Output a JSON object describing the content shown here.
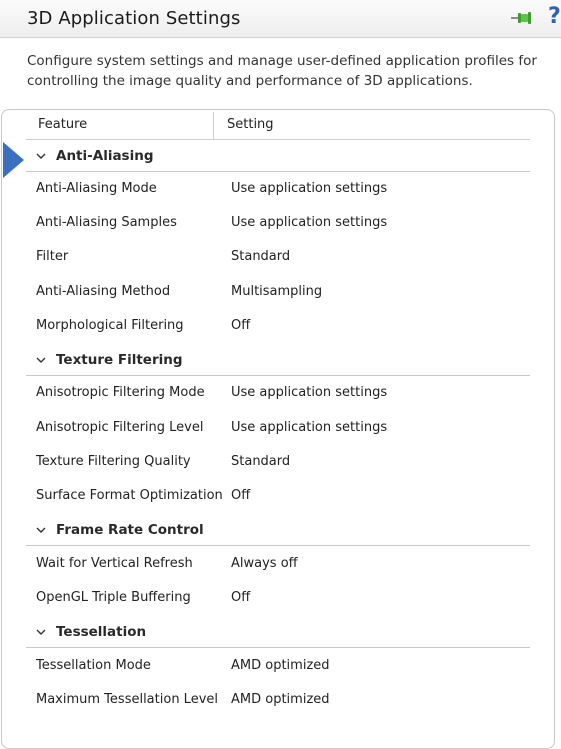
{
  "header": {
    "title": "3D Application Settings",
    "pin_icon": "pin-icon",
    "help_icon": "help-icon",
    "help_glyph": "?"
  },
  "description": "Configure system settings and manage user-defined application profiles for controlling the image quality and performance of 3D applications.",
  "table": {
    "columns": {
      "feature": "Feature",
      "setting": "Setting"
    },
    "groups": [
      {
        "label": "Anti-Aliasing",
        "rows": [
          {
            "feature": "Anti-Aliasing Mode",
            "setting": "Use application settings"
          },
          {
            "feature": "Anti-Aliasing Samples",
            "setting": "Use application settings"
          },
          {
            "feature": "Filter",
            "setting": "Standard"
          },
          {
            "feature": "Anti-Aliasing Method",
            "setting": "Multisampling"
          },
          {
            "feature": "Morphological Filtering",
            "setting": "Off"
          }
        ]
      },
      {
        "label": "Texture Filtering",
        "rows": [
          {
            "feature": "Anisotropic Filtering Mode",
            "setting": "Use application settings"
          },
          {
            "feature": "Anisotropic Filtering Level",
            "setting": "Use application settings"
          },
          {
            "feature": "Texture Filtering Quality",
            "setting": "Standard"
          },
          {
            "feature": "Surface Format Optimization",
            "setting": "Off"
          }
        ]
      },
      {
        "label": "Frame Rate Control",
        "rows": [
          {
            "feature": "Wait for Vertical Refresh",
            "setting": "Always off"
          },
          {
            "feature": "OpenGL Triple Buffering",
            "setting": "Off"
          }
        ]
      },
      {
        "label": "Tessellation",
        "rows": [
          {
            "feature": "Tessellation Mode",
            "setting": "AMD optimized"
          },
          {
            "feature": "Maximum Tessellation Level",
            "setting": "AMD optimized"
          }
        ]
      }
    ]
  },
  "colors": {
    "accent": "#3b6fbf",
    "help": "#2f64a8",
    "pin": "#4caf3a"
  }
}
